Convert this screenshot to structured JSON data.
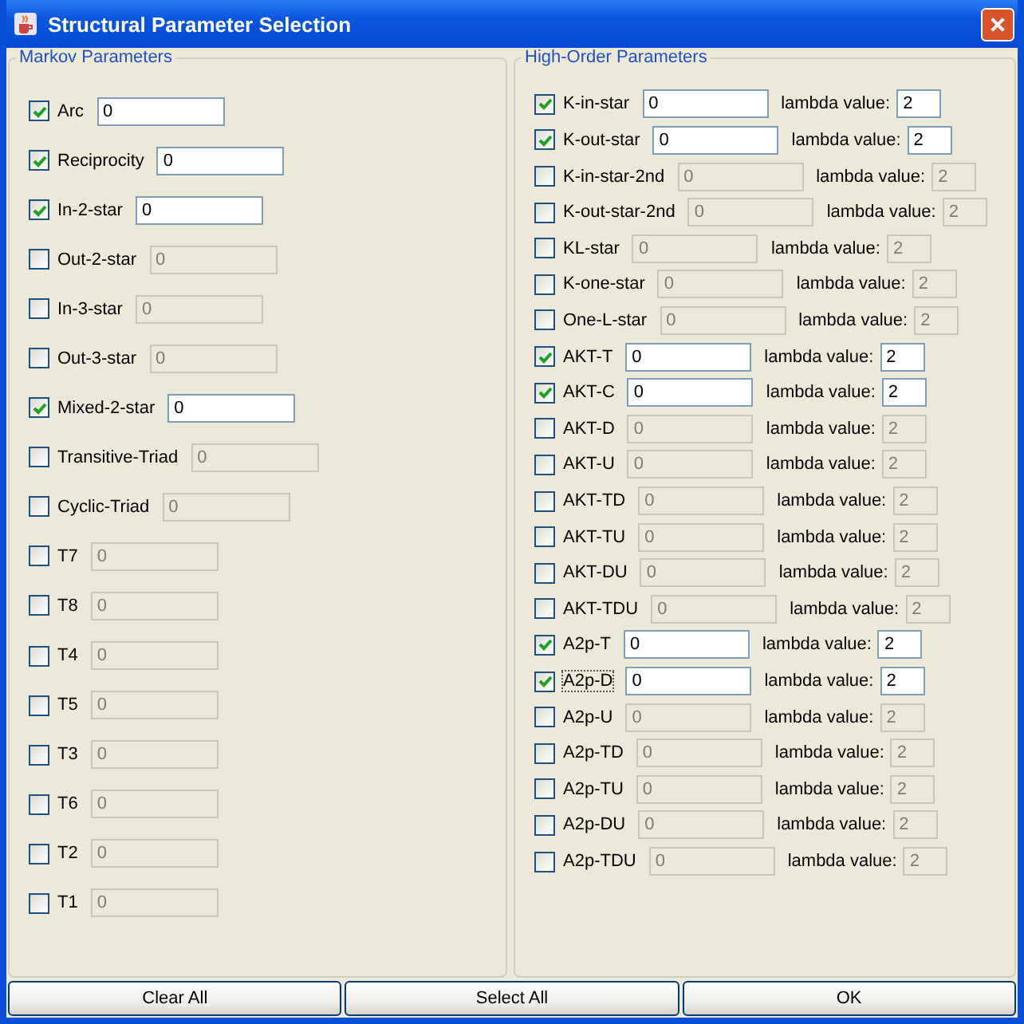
{
  "window": {
    "title": "Structural Parameter Selection"
  },
  "markov": {
    "title": "Markov Parameters",
    "items": [
      {
        "label": "Arc",
        "checked": true,
        "value": "0"
      },
      {
        "label": "Reciprocity",
        "checked": true,
        "value": "0"
      },
      {
        "label": "In-2-star",
        "checked": true,
        "value": "0"
      },
      {
        "label": "Out-2-star",
        "checked": false,
        "value": "0"
      },
      {
        "label": "In-3-star",
        "checked": false,
        "value": "0"
      },
      {
        "label": "Out-3-star",
        "checked": false,
        "value": "0"
      },
      {
        "label": "Mixed-2-star",
        "checked": true,
        "value": "0"
      },
      {
        "label": "Transitive-Triad",
        "checked": false,
        "value": "0"
      },
      {
        "label": "Cyclic-Triad",
        "checked": false,
        "value": "0"
      },
      {
        "label": "T7",
        "checked": false,
        "value": "0"
      },
      {
        "label": "T8",
        "checked": false,
        "value": "0"
      },
      {
        "label": "T4",
        "checked": false,
        "value": "0"
      },
      {
        "label": "T5",
        "checked": false,
        "value": "0"
      },
      {
        "label": "T3",
        "checked": false,
        "value": "0"
      },
      {
        "label": "T6",
        "checked": false,
        "value": "0"
      },
      {
        "label": "T2",
        "checked": false,
        "value": "0"
      },
      {
        "label": "T1",
        "checked": false,
        "value": "0"
      }
    ]
  },
  "high_order": {
    "title": "High-Order Parameters",
    "items": [
      {
        "label": "K-in-star",
        "checked": true,
        "focused": false,
        "value": "0",
        "lambda_label": "lambda value:",
        "lambda": "2"
      },
      {
        "label": "K-out-star",
        "checked": true,
        "focused": false,
        "value": "0",
        "lambda_label": "lambda value:",
        "lambda": "2"
      },
      {
        "label": "K-in-star-2nd",
        "checked": false,
        "focused": false,
        "value": "0",
        "lambda_label": "lambda value:",
        "lambda": "2"
      },
      {
        "label": "K-out-star-2nd",
        "checked": false,
        "focused": false,
        "value": "0",
        "lambda_label": "lambda value:",
        "lambda": "2"
      },
      {
        "label": "KL-star",
        "checked": false,
        "focused": false,
        "value": "0",
        "lambda_label": "lambda value:",
        "lambda": "2"
      },
      {
        "label": "K-one-star",
        "checked": false,
        "focused": false,
        "value": "0",
        "lambda_label": "lambda value:",
        "lambda": "2"
      },
      {
        "label": "One-L-star",
        "checked": false,
        "focused": false,
        "value": "0",
        "lambda_label": "lambda value:",
        "lambda": "2"
      },
      {
        "label": "AKT-T",
        "checked": true,
        "focused": false,
        "value": "0",
        "lambda_label": "lambda value:",
        "lambda": "2"
      },
      {
        "label": "AKT-C",
        "checked": true,
        "focused": false,
        "value": "0",
        "lambda_label": "lambda value:",
        "lambda": "2"
      },
      {
        "label": "AKT-D",
        "checked": false,
        "focused": false,
        "value": "0",
        "lambda_label": "lambda value:",
        "lambda": "2"
      },
      {
        "label": "AKT-U",
        "checked": false,
        "focused": false,
        "value": "0",
        "lambda_label": "lambda value:",
        "lambda": "2"
      },
      {
        "label": "AKT-TD",
        "checked": false,
        "focused": false,
        "value": "0",
        "lambda_label": "lambda value:",
        "lambda": "2"
      },
      {
        "label": "AKT-TU",
        "checked": false,
        "focused": false,
        "value": "0",
        "lambda_label": "lambda value:",
        "lambda": "2"
      },
      {
        "label": "AKT-DU",
        "checked": false,
        "focused": false,
        "value": "0",
        "lambda_label": "lambda value:",
        "lambda": "2"
      },
      {
        "label": "AKT-TDU",
        "checked": false,
        "focused": false,
        "value": "0",
        "lambda_label": "lambda value:",
        "lambda": "2"
      },
      {
        "label": "A2p-T",
        "checked": true,
        "focused": false,
        "value": "0",
        "lambda_label": "lambda value:",
        "lambda": "2"
      },
      {
        "label": "A2p-D",
        "checked": true,
        "focused": true,
        "value": "0",
        "lambda_label": "lambda value:",
        "lambda": "2"
      },
      {
        "label": "A2p-U",
        "checked": false,
        "focused": false,
        "value": "0",
        "lambda_label": "lambda value:",
        "lambda": "2"
      },
      {
        "label": "A2p-TD",
        "checked": false,
        "focused": false,
        "value": "0",
        "lambda_label": "lambda value:",
        "lambda": "2"
      },
      {
        "label": "A2p-TU",
        "checked": false,
        "focused": false,
        "value": "0",
        "lambda_label": "lambda value:",
        "lambda": "2"
      },
      {
        "label": "A2p-DU",
        "checked": false,
        "focused": false,
        "value": "0",
        "lambda_label": "lambda value:",
        "lambda": "2"
      },
      {
        "label": "A2p-TDU",
        "checked": false,
        "focused": false,
        "value": "0",
        "lambda_label": "lambda value:",
        "lambda": "2"
      }
    ]
  },
  "buttons": [
    "Clear All",
    "Select All",
    "OK"
  ]
}
